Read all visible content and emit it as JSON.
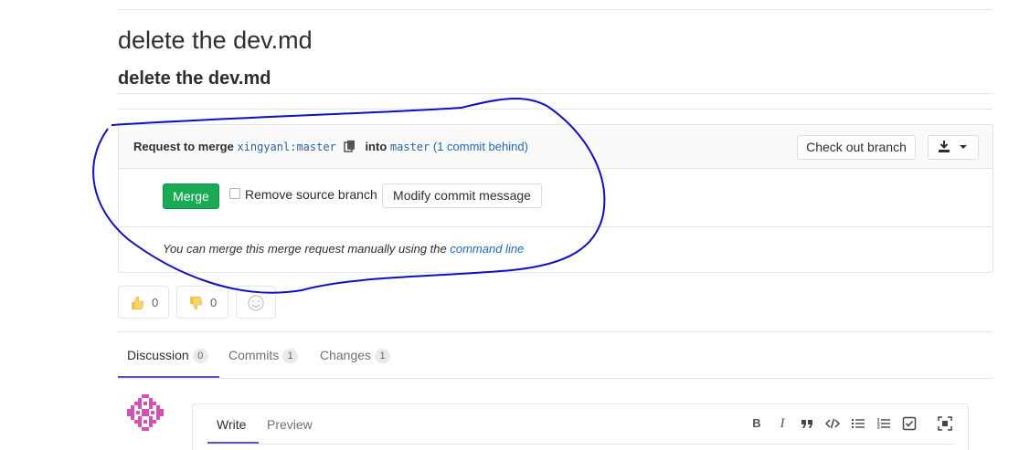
{
  "issue": {
    "title": "delete the dev.md",
    "description_heading": "delete the dev.md"
  },
  "merge_widget": {
    "request_prefix": "Request to merge",
    "source_branch": "xingyanl:master",
    "into_text": "into",
    "target_branch": "master",
    "behind_text": "(1 commit behind)",
    "checkout_button": "Check out branch",
    "merge_button": "Merge",
    "remove_source_label": "Remove source branch",
    "modify_commit_button": "Modify commit message",
    "footer_text": "You can merge this merge request manually using the",
    "footer_link": "command line",
    "colors": {
      "merge": "#1aaa55",
      "link": "#1b69b6"
    }
  },
  "awards": {
    "thumbs_up_count": "0",
    "thumbs_down_count": "0",
    "icons": [
      "thumbs-up-icon",
      "thumbs-down-icon",
      "smiley-icon"
    ]
  },
  "tabs": [
    {
      "label": "Discussion",
      "count": "0",
      "active": true
    },
    {
      "label": "Commits",
      "count": "1",
      "active": false
    },
    {
      "label": "Changes",
      "count": "1",
      "active": false
    }
  ],
  "comment_form": {
    "write_tab": "Write",
    "preview_tab": "Preview",
    "toolbar": {
      "bold": "B",
      "italic": "I",
      "icons": [
        "bold-icon",
        "italic-icon",
        "quote-icon",
        "code-icon",
        "bullet-list-icon",
        "numbered-list-icon",
        "task-list-icon",
        "fullscreen-icon"
      ]
    }
  },
  "accent_color": "#6b4fbb"
}
